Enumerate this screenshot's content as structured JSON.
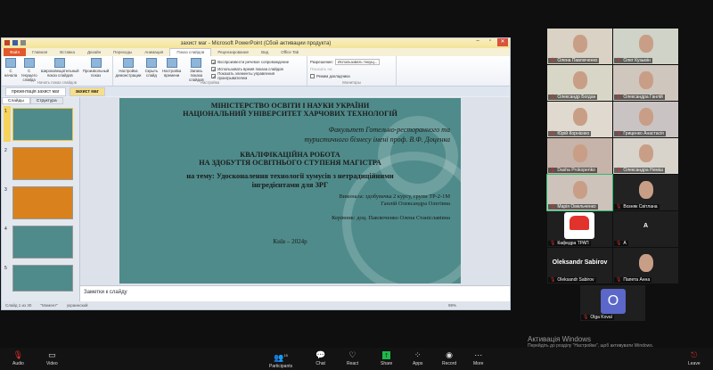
{
  "ppt": {
    "title": "захист маг - Microsoft PowerPoint (Сбой активации продукта)",
    "tabs": [
      "Файл",
      "Главная",
      "Вставка",
      "Дизайн",
      "Переходы",
      "Анимация",
      "Показ слайдов",
      "Рецензирование",
      "Вид",
      "Office Tab"
    ],
    "ribbon": {
      "start_group": "Начать показ слайдов",
      "setup_group": "Настройка",
      "monitor_group": "Мониторы",
      "buttons": [
        "С начала",
        "С текущего слайда",
        "Широковещательный показ слайдов",
        "Произвольный показ",
        "Настройка демонстрации",
        "Скрыть слайд",
        "Настройка времени",
        "Запись показа слайдов"
      ],
      "checks": [
        "Воспроизвести речевое сопровождение",
        "Использовать время показа слайдов",
        "Показать элементы управления проигрывателем"
      ],
      "resolution_label": "Разрешение:",
      "resolution_value": "Использовать текущ...",
      "show_on_label": "Показать на:",
      "presenter_view": "Режим докладчика"
    },
    "doc_tabs": [
      "презентація захист маг",
      "захист маг"
    ],
    "panel_tabs": [
      "Слайды",
      "Структура"
    ],
    "thumbs": [
      "1",
      "2",
      "3",
      "4",
      "5"
    ],
    "slide": {
      "l1": "МІНІСТЕРСТВО ОСВІТИ І НАУКИ УКРАЇНИ",
      "l2": "НАЦІОНАЛЬНИЙ  УНІВЕРСИТЕТ ХАРЧОВИХ ТЕХНОЛОГІЙ",
      "f1": "Факультет Готельно-ресторанного та",
      "f2": "туристичного бізнесу імені проф. В.Ф. Доценка",
      "t1": "КВАЛІФІКАЦІЙНА РОБОТА",
      "t2": "НА ЗДОБУТТЯ ОСВІТНЬОГО СТУПЕНЯ МАГІСТРА",
      "th1": "на тему: Удосконалення технології хумусів з нетрадиційними",
      "th2": "інгредієнтами для ЗРГ",
      "a1": "Виконала:  здобувачка 2 курсу, групи ТР-2-1М",
      "a2": "Ганлій Олександра Олегівна",
      "sup": "Керівник: доц. Павлюченко Олена Станіславівна",
      "city": "Київ – 2024р"
    },
    "notes": "Заметки к слайду",
    "status": {
      "slide": "Слайд 1 из 30",
      "theme": "\"Момент\"",
      "lang": "украинский",
      "zoom": "99%"
    }
  },
  "participants": [
    {
      "name": "Олена Павлюченко"
    },
    {
      "name": "Олег Кузьмін"
    },
    {
      "name": "Олександр Богдан"
    },
    {
      "name": "Олександра Ганлій"
    },
    {
      "name": "Юрій Корнієнко"
    },
    {
      "name": "Гриценко Анастасія"
    },
    {
      "name": "Dasha Prokopenko"
    },
    {
      "name": "Олександра Неміш"
    },
    {
      "name": "Марія Омельченко"
    },
    {
      "name": "Возняк Світлана"
    },
    {
      "name": "Кафедра ТРАП"
    },
    {
      "name": "A",
      "big": "A"
    },
    {
      "name": "Oleksandr Sabirov",
      "big": "Oleksandr Sabirov"
    },
    {
      "name": "Папета Анна"
    },
    {
      "name": "Olga Koval",
      "initial": "O"
    }
  ],
  "toolbar": {
    "audio": "Audio",
    "video": "Video",
    "participants": "Participants",
    "participants_count": "15",
    "chat": "Chat",
    "react": "React",
    "share": "Share",
    "apps": "Apps",
    "record": "Record",
    "more": "More",
    "leave": "Leave"
  },
  "activation": {
    "title": "Активація Windows",
    "sub": "Перейдіть до розділу \"Настройки\", щоб активувати Windows."
  },
  "colors": {
    "slide_bg": "#4f8b8a",
    "share_green": "#1fb84a",
    "active_speaker": "#2dbd6e",
    "avatar": "#5b67c9"
  }
}
